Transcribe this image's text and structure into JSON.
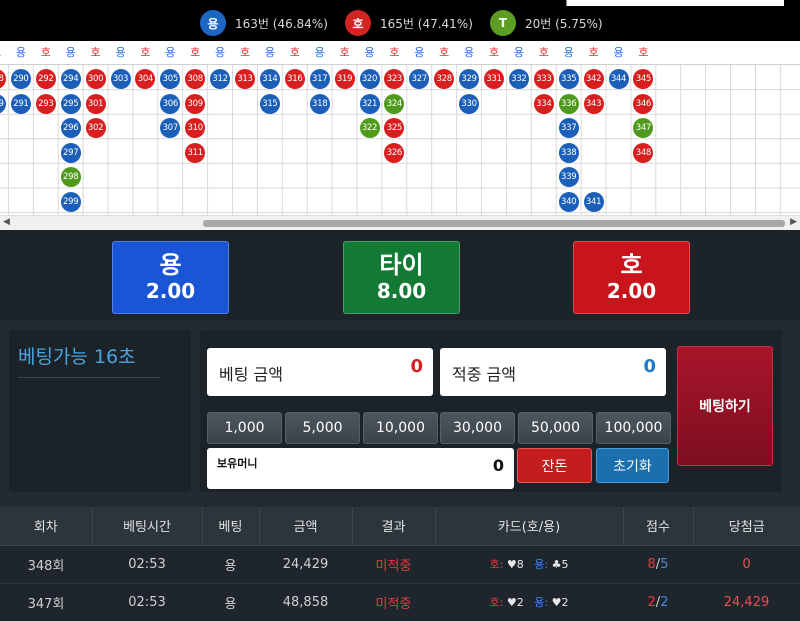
{
  "stats": [
    {
      "icon_label": "용",
      "text": "163번 (46.84%)",
      "color": "#1e66c6"
    },
    {
      "icon_label": "호",
      "text": "165번 (47.41%)",
      "color": "#d32424"
    },
    {
      "icon_label": "T",
      "text": "20번 (5.75%)",
      "color": "#5c9e24"
    }
  ],
  "roadmap": {
    "header": [
      "호",
      "용",
      "호",
      "용",
      "호",
      "용",
      "호",
      "용",
      "호",
      "용",
      "호",
      "용",
      "호",
      "용",
      "호",
      "용",
      "호",
      "용",
      "호",
      "용",
      "호",
      "용",
      "호",
      "용",
      "호",
      "용",
      "호"
    ],
    "columns": [
      [
        "288",
        "289"
      ],
      [
        "290",
        "291"
      ],
      [
        "292",
        "293"
      ],
      [
        "294",
        "295",
        "296",
        "297",
        "298",
        "299"
      ],
      [
        "300",
        "301",
        "302"
      ],
      [
        "303"
      ],
      [
        "304"
      ],
      [
        "305",
        "306",
        "307"
      ],
      [
        "308",
        "309",
        "310",
        "311"
      ],
      [
        "312"
      ],
      [
        "313"
      ],
      [
        "314",
        "315"
      ],
      [
        "316"
      ],
      [
        "317",
        "318"
      ],
      [
        "319"
      ],
      [
        "320",
        "321",
        "322"
      ],
      [
        "323",
        "324",
        "325",
        "326"
      ],
      [
        "327"
      ],
      [
        "328"
      ],
      [
        "329",
        "330"
      ],
      [
        "331"
      ],
      [
        "332"
      ],
      [
        "333",
        "334"
      ],
      [
        "335",
        "336",
        "337",
        "338",
        "339",
        "340"
      ],
      [
        "342",
        "343",
        "",
        "",
        "",
        "341"
      ],
      [
        "344"
      ],
      [
        "345",
        "346",
        "347",
        "348"
      ]
    ],
    "colors": [
      [
        "r",
        "b"
      ],
      [
        "b",
        "b"
      ],
      [
        "r",
        "r"
      ],
      [
        "b",
        "b",
        "b",
        "b",
        "g",
        "b"
      ],
      [
        "r",
        "r",
        "r"
      ],
      [
        "b"
      ],
      [
        "r"
      ],
      [
        "b",
        "b",
        "b"
      ],
      [
        "r",
        "r",
        "r",
        "r"
      ],
      [
        "b"
      ],
      [
        "r"
      ],
      [
        "b",
        "b"
      ],
      [
        "r"
      ],
      [
        "b",
        "b"
      ],
      [
        "r"
      ],
      [
        "b",
        "b",
        "g"
      ],
      [
        "r",
        "g",
        "r",
        "r"
      ],
      [
        "b"
      ],
      [
        "r"
      ],
      [
        "b",
        "b"
      ],
      [
        "r"
      ],
      [
        "b"
      ],
      [
        "r",
        "r"
      ],
      [
        "b",
        "g",
        "b",
        "b",
        "b",
        "b"
      ],
      [
        "r",
        "r",
        "",
        "",
        "",
        "b"
      ],
      [
        "b"
      ],
      [
        "r",
        "r",
        "g",
        "r"
      ]
    ]
  },
  "bet_options": {
    "dragon": {
      "name": "용",
      "odds": "2.00"
    },
    "tie": {
      "name": "타이",
      "odds": "8.00"
    },
    "tiger": {
      "name": "호",
      "odds": "2.00"
    }
  },
  "timer": {
    "label": "베팅가능 16초"
  },
  "form": {
    "bet_label": "베팅 금액",
    "bet_value": "0",
    "win_label": "적중 금액",
    "win_value": "0",
    "chips": [
      "1,000",
      "5,000",
      "10,000",
      "30,000",
      "50,000",
      "100,000"
    ],
    "balance_label": "보유머니",
    "balance_value": "0",
    "allin_label": "잔돈",
    "reset_label": "초기화",
    "place_label": "베팅하기"
  },
  "history": {
    "headers": [
      "회차",
      "베팅시간",
      "베팅",
      "금액",
      "결과",
      "카드(호/용)",
      "점수",
      "당첨금"
    ],
    "rows": [
      {
        "round": "348회",
        "time": "02:53",
        "bet": "용",
        "amount": "24,429",
        "result": "미적중",
        "card_tiger_label": "호:",
        "card_tiger": "♥8",
        "card_dragon_label": "용:",
        "card_dragon": "♣5",
        "score_a": "8",
        "score_sep": "/",
        "score_b": "5",
        "payout": "0"
      },
      {
        "round": "347회",
        "time": "02:53",
        "bet": "용",
        "amount": "48,858",
        "result": "미적중",
        "card_tiger_label": "호:",
        "card_tiger": "♥2",
        "card_dragon_label": "용:",
        "card_dragon": "♥2",
        "score_a": "2",
        "score_sep": "/",
        "score_b": "2",
        "payout": "24,429"
      }
    ]
  }
}
